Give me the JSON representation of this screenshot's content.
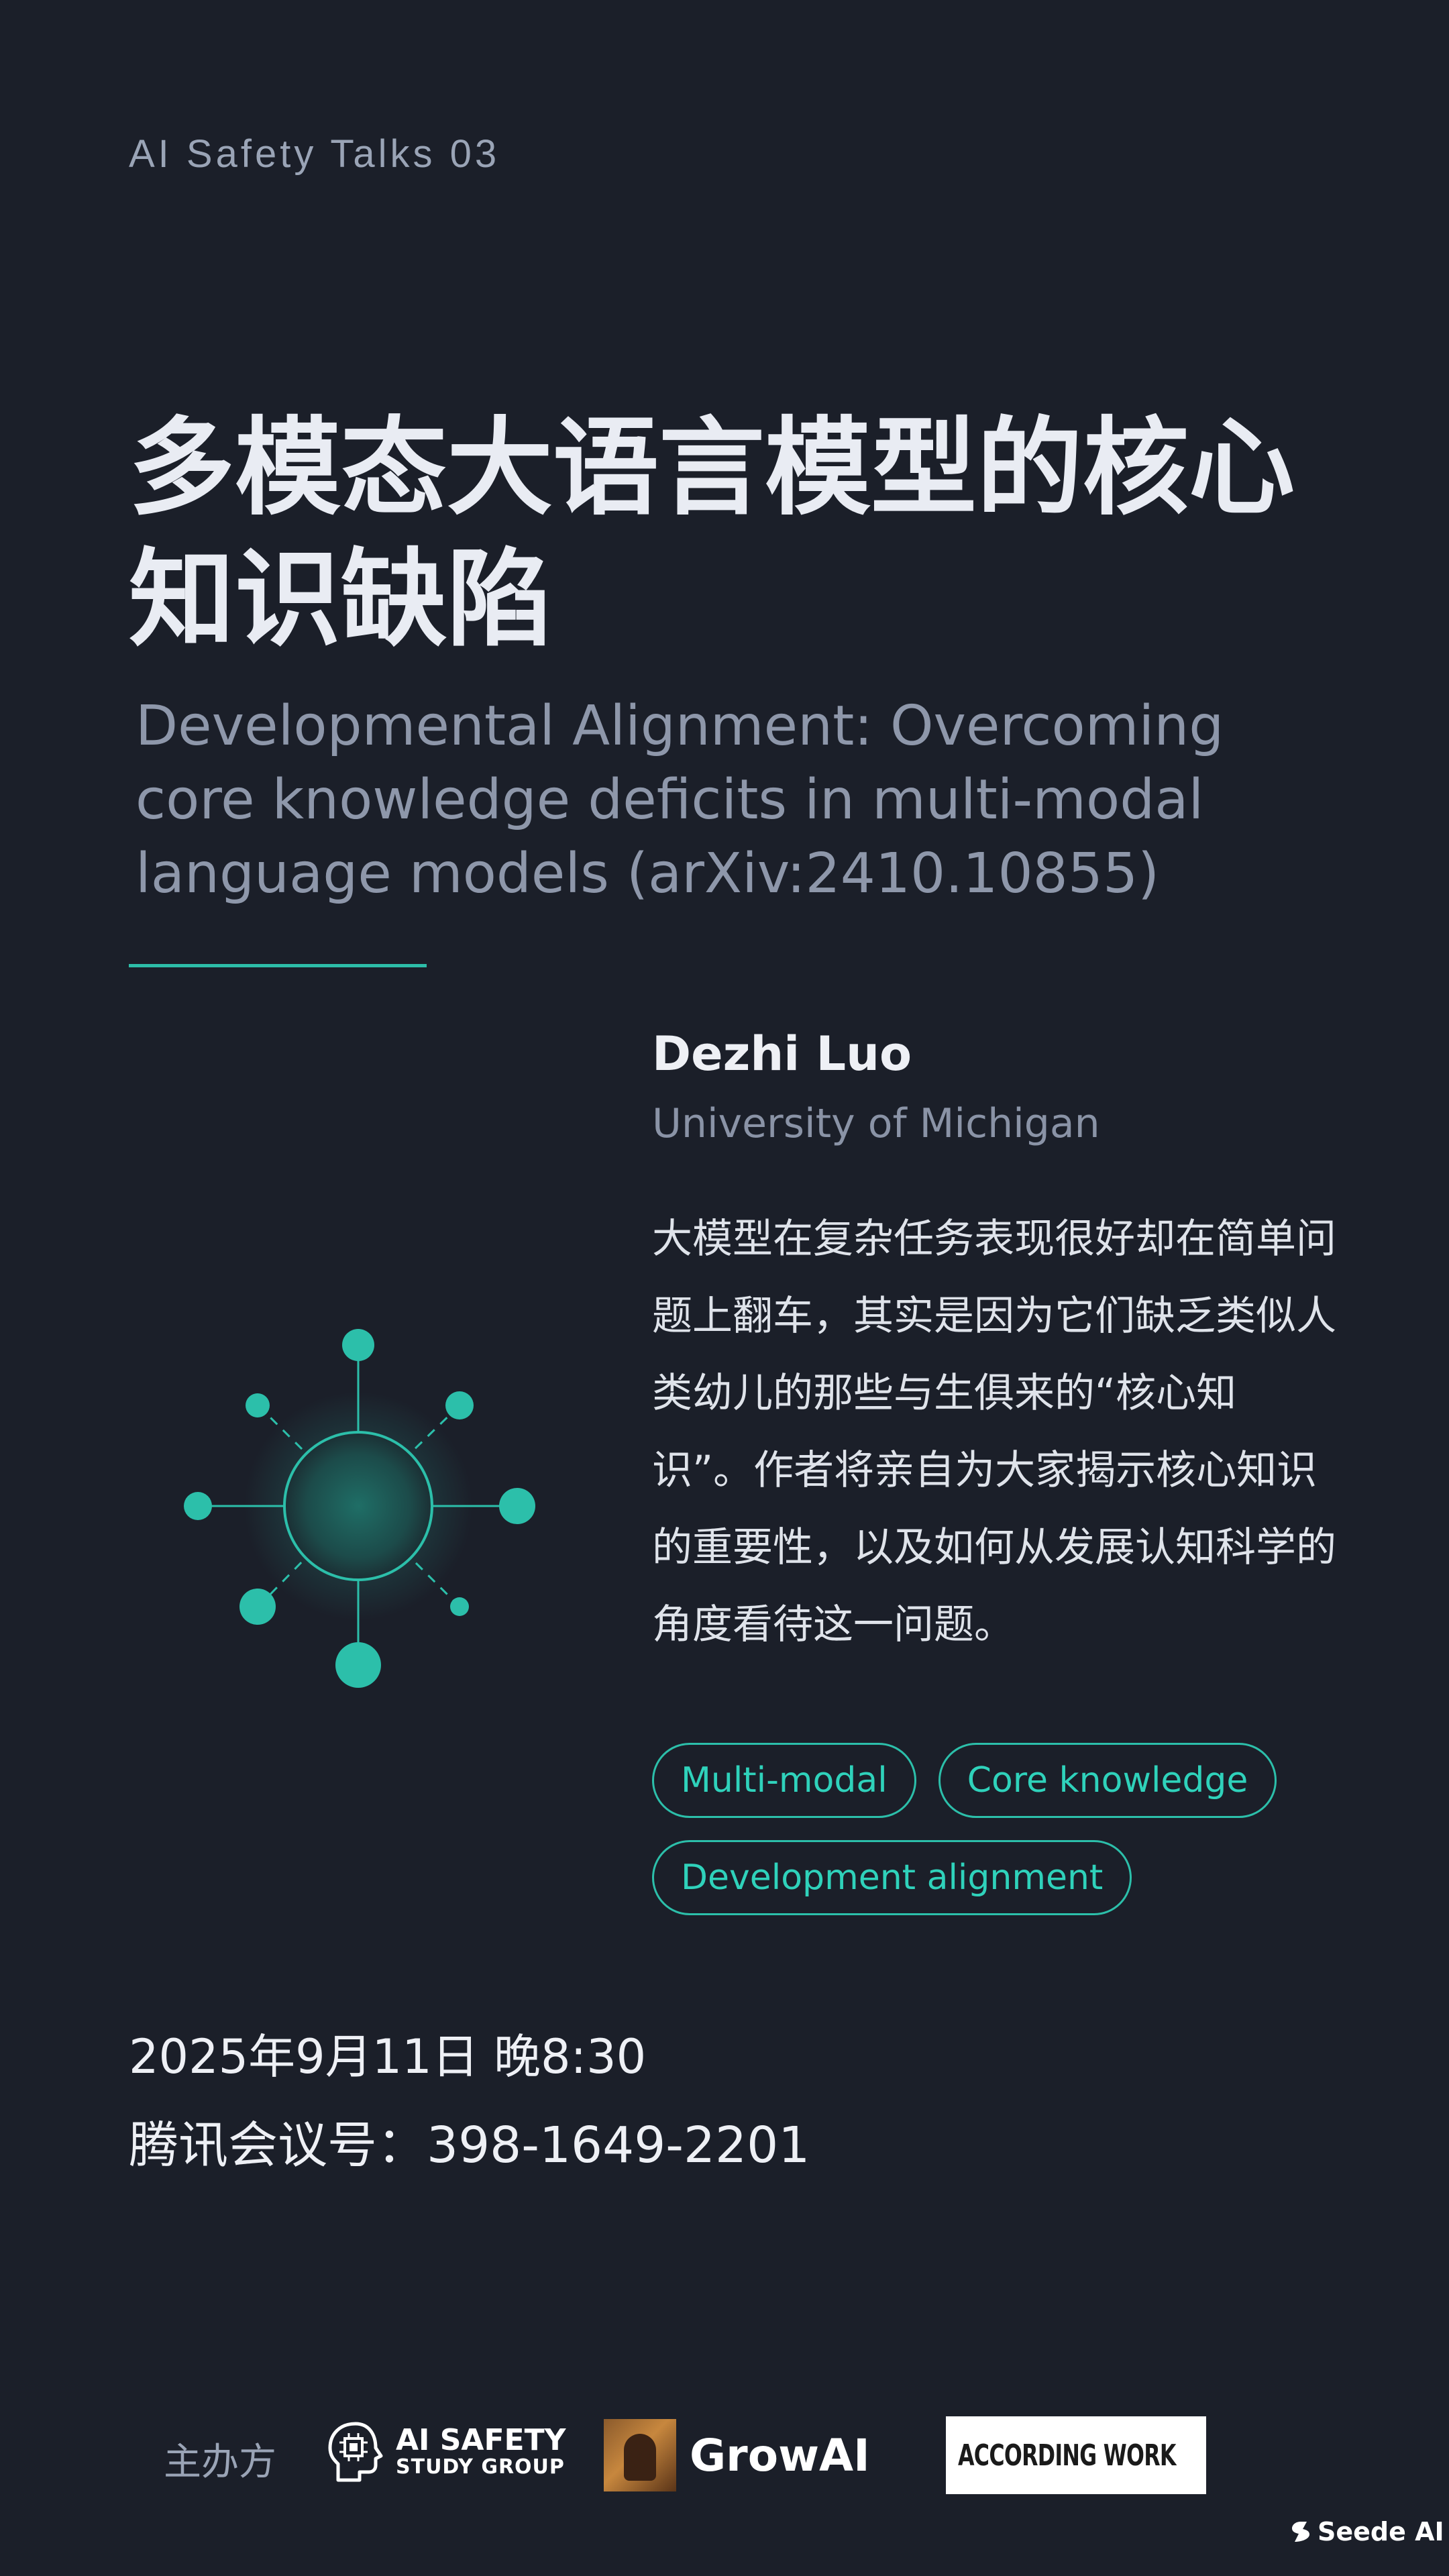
{
  "header": {
    "series": "AI Safety Talks 03"
  },
  "talk": {
    "title": "多模态大语言模型的核心知识缺陷",
    "subtitle": "Developmental Alignment: Overcoming core knowledge deficits in multi-modal language models (arXiv:2410.10855)",
    "speaker": "Dezhi Luo",
    "affiliation": "University of Michigan",
    "description": "大模型在复杂任务表现很好却在简单问题上翻车，其实是因为它们缺乏类似人类幼儿的那些与生俱来的“核心知识”。作者将亲自为大家揭示核心知识的重要性，以及如何从发展认知科学的角度看待这一问题。",
    "tags": [
      "Multi-modal",
      "Core knowledge",
      "Development alignment"
    ]
  },
  "schedule": {
    "date": "2025年9月11日 晚8:30",
    "meeting": "腾讯会议号：398-1649-2201"
  },
  "organizers": {
    "label": "主办方",
    "ai_safety_line1": "AI SAFETY",
    "ai_safety_line2": "STUDY GROUP",
    "growai": "GrowAI",
    "according_work": "ACCORDING WORK"
  },
  "watermark": "Seede AI",
  "colors": {
    "background": "#1b1f29",
    "accent": "#2cbfaa",
    "text": "#e9ecf3",
    "muted": "#8e97aa"
  },
  "icons": {
    "hero": "molecule-network-icon",
    "ai_safety": "brain-chip-icon",
    "according_work": "diamond-logo-icon",
    "watermark": "seede-logo-icon"
  }
}
